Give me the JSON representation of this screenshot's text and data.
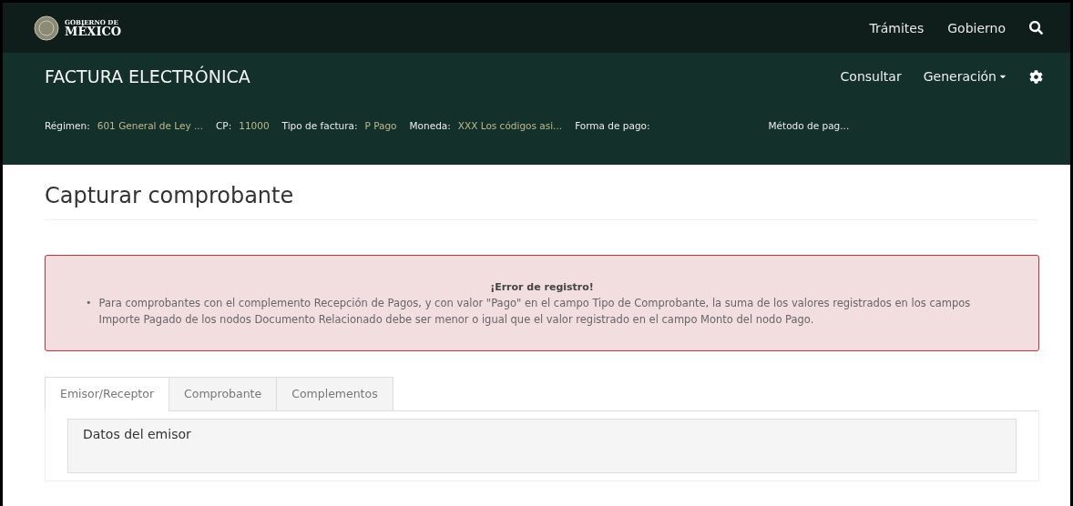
{
  "top_bar": {
    "logo_small": "GOBIERNO DE",
    "logo_big": "MÉXICO",
    "links": [
      "Trámites",
      "Gobierno"
    ]
  },
  "header": {
    "title": "FACTURA ELECTRÓNICA",
    "nav": [
      {
        "label": "Consultar",
        "dropdown": false
      },
      {
        "label": "Generación",
        "dropdown": true
      }
    ]
  },
  "info": [
    {
      "label": "Régimen:",
      "value": "601 General de Ley ..."
    },
    {
      "label": "CP:",
      "value": "11000"
    },
    {
      "label": "Tipo de factura:",
      "value": "P Pago"
    },
    {
      "label": "Moneda:",
      "value": "XXX Los códigos asi..."
    },
    {
      "label": "Forma de pago:"
    },
    {
      "label": "Método de pag..."
    }
  ],
  "page_title": "Capturar comprobante",
  "alert": {
    "title": "¡Error de registro!",
    "items": [
      {
        "bullet": "•",
        "text": "Para comprobantes con el complemento Recepción de Pagos, y con valor \"Pago\" en el campo Tipo de Comprobante, la suma de los valores registrados en los campos Importe Pagado de los nodos Documento Relacionado debe ser menor o igual que el valor registrado en el campo Monto del nodo Pago."
      }
    ]
  },
  "tabs": [
    {
      "label": "Emisor/Receptor",
      "selected": true
    },
    {
      "label": "Comprobante",
      "selected": false
    },
    {
      "label": "Complementos",
      "selected": false
    }
  ],
  "section": {
    "title": "Datos del emisor"
  }
}
